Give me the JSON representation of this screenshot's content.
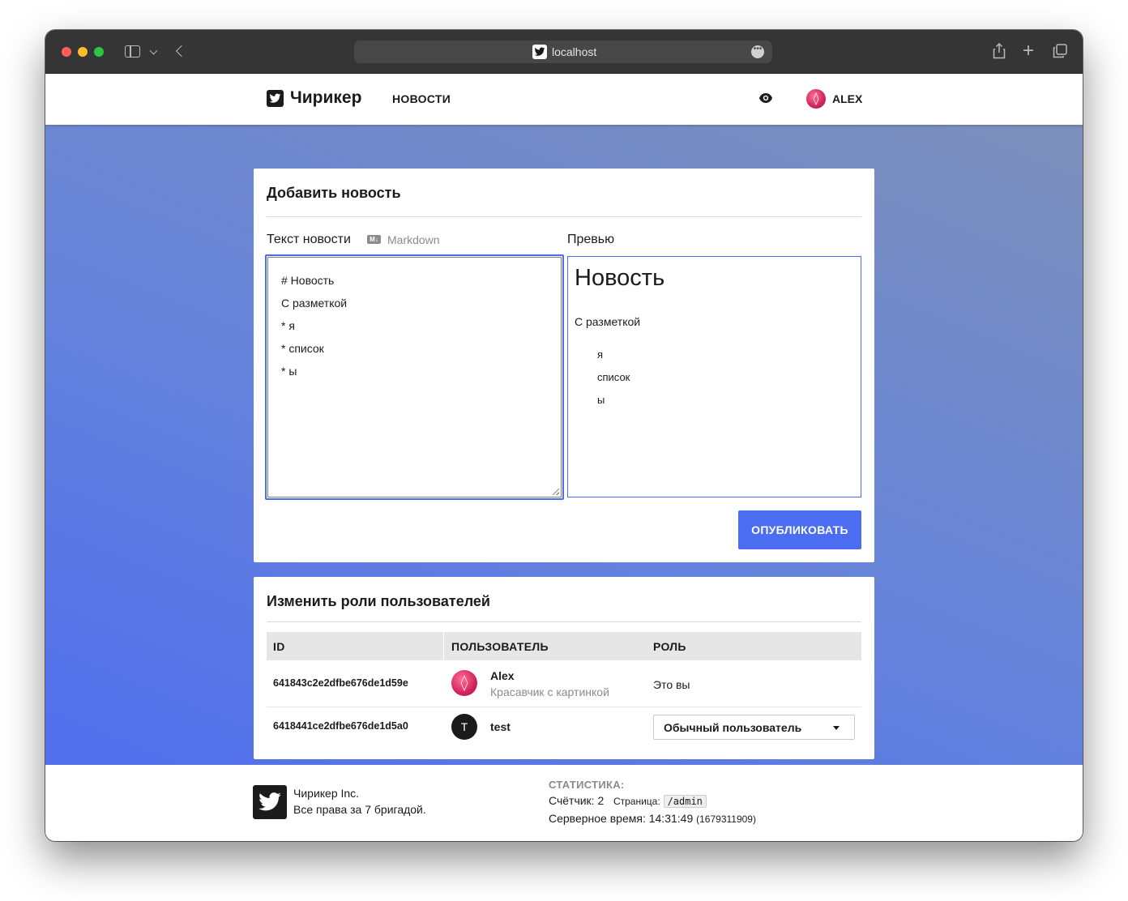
{
  "browser": {
    "url": "localhost"
  },
  "navbar": {
    "brand": "Чирикер",
    "news_link": "НОВОСТИ",
    "user_name": "ALEX"
  },
  "add_news": {
    "title": "Добавить новость",
    "text_label": "Текст новости",
    "markdown_badge": "M↓",
    "markdown_label": "Markdown",
    "preview_label": "Превью",
    "editor_lines": [
      "# Новость",
      "С разметкой",
      "* я",
      "* список",
      "* ы"
    ],
    "preview": {
      "heading": "Новость",
      "paragraph": "С разметкой",
      "list": [
        "я",
        "список",
        "ы"
      ]
    },
    "publish_button": "ОПУБЛИКОВАТЬ",
    "accent_color": "#4a6df2"
  },
  "roles": {
    "title": "Изменить роли пользователей",
    "columns": [
      "ID",
      "ПОЛЬЗОВАТЕЛЬ",
      "РОЛЬ"
    ],
    "rows": [
      {
        "id": "641843c2e2dfbe676de1d59e",
        "name": "Alex",
        "subtitle": "Красавчик с картинкой",
        "role": "Это вы"
      },
      {
        "id": "6418441ce2dfbe676de1d5a0",
        "avatar_letter": "T",
        "name": "test",
        "role_select": "Обычный пользователь"
      }
    ]
  },
  "footer": {
    "company": "Чирикер Inc.",
    "rights": "Все права за 7 бригадой.",
    "stats_title": "СТАТИСТИКА:",
    "counter_label": "Счётчик:",
    "counter_value": "2",
    "page_label": "Страница:",
    "page_value": "/admin",
    "server_time_label": "Серверное время:",
    "server_time": "14:31:49",
    "server_timestamp": "(1679311909)"
  }
}
